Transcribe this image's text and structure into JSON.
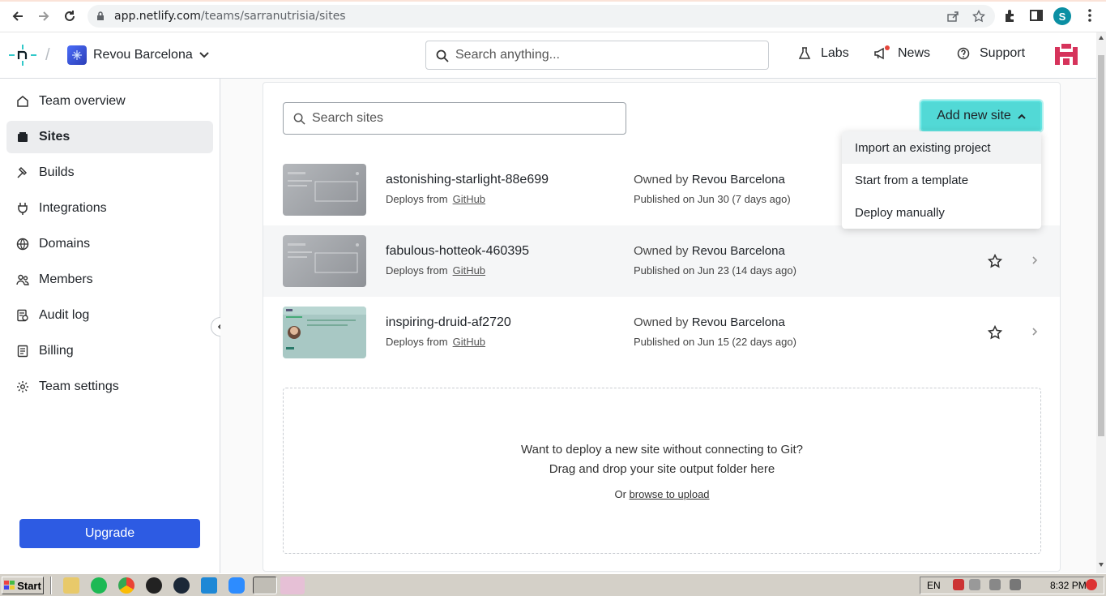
{
  "browser": {
    "url_host": "app.netlify.com",
    "url_path": "/teams/sarranutrisia/sites",
    "profile_initial": "S"
  },
  "header": {
    "team_name": "Revou Barcelona",
    "search_placeholder": "Search anything...",
    "nav": [
      {
        "label": "Labs",
        "icon": "flask-icon"
      },
      {
        "label": "News",
        "icon": "megaphone-icon"
      },
      {
        "label": "Support",
        "icon": "help-circle-icon"
      }
    ]
  },
  "sidebar": {
    "items": [
      {
        "label": "Team overview",
        "icon": "home-icon",
        "active": false
      },
      {
        "label": "Sites",
        "icon": "sites-icon",
        "active": true
      },
      {
        "label": "Builds",
        "icon": "hammer-icon",
        "active": false
      },
      {
        "label": "Integrations",
        "icon": "plug-icon",
        "active": false
      },
      {
        "label": "Domains",
        "icon": "globe-icon",
        "active": false
      },
      {
        "label": "Members",
        "icon": "users-icon",
        "active": false
      },
      {
        "label": "Audit log",
        "icon": "audit-icon",
        "active": false
      },
      {
        "label": "Billing",
        "icon": "receipt-icon",
        "active": false
      },
      {
        "label": "Team settings",
        "icon": "gear-icon",
        "active": false
      }
    ],
    "upgrade_label": "Upgrade"
  },
  "sites": {
    "search_placeholder": "Search sites",
    "add_button_label": "Add new site",
    "menu": [
      "Import an existing project",
      "Start from a template",
      "Deploy manually"
    ],
    "rows": [
      {
        "name": "astonishing-starlight-88e699",
        "deploys_prefix": "Deploys from",
        "deploys_source": "GitHub",
        "owned_prefix": "Owned by",
        "owner": "Revou Barcelona",
        "published": "Published on Jun 30 (7 days ago)"
      },
      {
        "name": "fabulous-hotteok-460395",
        "deploys_prefix": "Deploys from",
        "deploys_source": "GitHub",
        "owned_prefix": "Owned by",
        "owner": "Revou Barcelona",
        "published": "Published on Jun 23 (14 days ago)"
      },
      {
        "name": "inspiring-druid-af2720",
        "deploys_prefix": "Deploys from",
        "deploys_source": "GitHub",
        "owned_prefix": "Owned by",
        "owner": "Revou Barcelona",
        "published": "Published on Jun 15 (22 days ago)"
      }
    ],
    "dropzone": {
      "line1": "Want to deploy a new site without connecting to Git?",
      "line2": "Drag and drop your site output folder here",
      "or": "Or",
      "browse_label": "browse to upload"
    }
  },
  "taskbar": {
    "start_label": "Start",
    "language": "EN",
    "clock": "8:32 PM"
  },
  "colors": {
    "accent_teal": "#52d9d6",
    "upgrade_blue": "#2d5be3",
    "netlify_teal": "#30c8c9"
  }
}
